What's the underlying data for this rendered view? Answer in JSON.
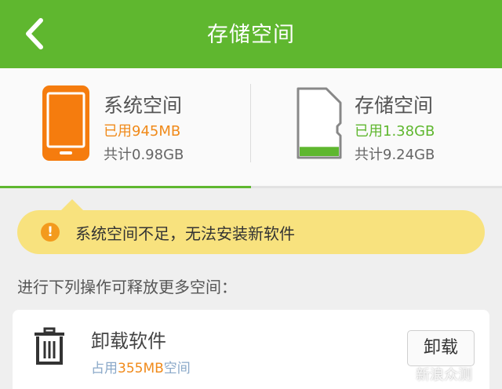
{
  "header": {
    "title": "存储空间",
    "back_icon": "chevron-left-icon"
  },
  "storage": {
    "system": {
      "name": "系统空间",
      "used": "已用945MB",
      "total": "共计0.98GB",
      "used_color": "#f08a1a"
    },
    "external": {
      "name": "存储空间",
      "used": "已用1.38GB",
      "total": "共计9.24GB",
      "used_color": "#5fb72f",
      "fill_fraction": 0.15
    },
    "selected_tab_fraction": 0.5
  },
  "warning": {
    "text": "系统空间不足，无法安装新软件",
    "icon": "!"
  },
  "hint": "进行下列操作可释放更多空间：",
  "card": {
    "title": "卸载软件",
    "sub_prefix": "占用",
    "sub_value": "355MB",
    "sub_suffix": "空间",
    "button": "卸载"
  },
  "watermark": "新浪众测",
  "colors": {
    "accent": "#5fb72f",
    "warning_bg": "#f8e27e",
    "warning_icon": "#f39a1d",
    "phone_orange": "#f57c0e"
  }
}
